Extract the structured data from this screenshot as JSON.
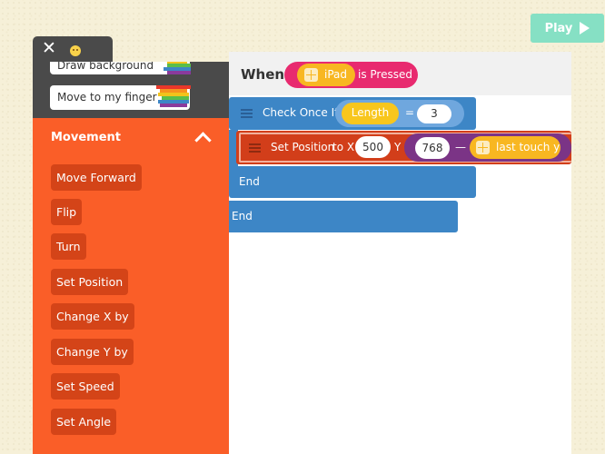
{
  "toolbar": {
    "play_label": "Play",
    "close_label": "✕"
  },
  "library": {
    "snippets": [
      "Draw background",
      "Move to my finger"
    ],
    "section_title": "Movement",
    "blocks": [
      "Move Forward",
      "Flip",
      "Turn",
      "Set Position",
      "Change X by",
      "Change Y by",
      "Set Speed",
      "Set Angle"
    ]
  },
  "code": {
    "when_label": "When",
    "trigger_object": "iPad",
    "trigger_event": "is Pressed",
    "check_label": "Check Once If",
    "condition_trait": "Length",
    "condition_operator": "=",
    "condition_value": "3",
    "set_position_label": "Set Position",
    "to_x_label": "to X",
    "x_value": "500",
    "y_label": "Y",
    "y_value": "768",
    "minus_operator": "—",
    "last_touch_label": "last touch y",
    "end_inner": "End",
    "end_outer": "End"
  },
  "colors": {
    "movement": "#fa5e28",
    "control": "#3d86c6",
    "trigger": "#e82a6f",
    "play": "#86e0c4"
  }
}
